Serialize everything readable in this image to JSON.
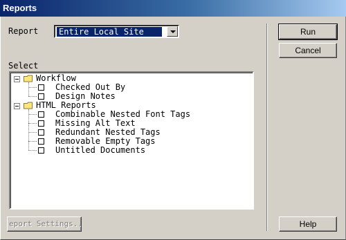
{
  "window": {
    "title": "Reports"
  },
  "report": {
    "label": "Report",
    "value": "Entire Local Site"
  },
  "select": {
    "label": "Select"
  },
  "tree": [
    {
      "label": "Workflow",
      "children": [
        "Checked Out By",
        "Design Notes"
      ]
    },
    {
      "label": "HTML Reports",
      "children": [
        "Combinable Nested Font Tags",
        "Missing Alt Text",
        "Redundant Nested Tags",
        "Removable Empty Tags",
        "Untitled Documents"
      ]
    }
  ],
  "buttons": {
    "run": "Run",
    "cancel": "Cancel",
    "report_settings": "eport Settings..",
    "help": "Help"
  }
}
